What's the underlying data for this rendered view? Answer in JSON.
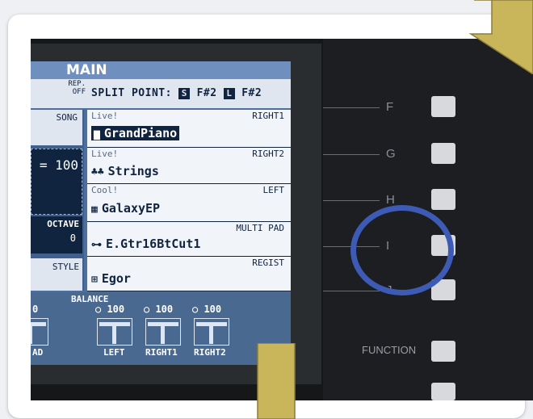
{
  "lcd": {
    "title": "MAIN",
    "rep_label": "REP.",
    "rep_value": "OFF",
    "split_point_label": "SPLIT POINT:",
    "split_s_icon": "S",
    "split_s_value": "F#2",
    "split_l_icon": "L",
    "split_l_value": "F#2",
    "song_label": "SONG",
    "tempo_value": "= 100",
    "octave_label": "OCTAVE",
    "octave_value": "0",
    "style_label": "STYLE",
    "voices": [
      {
        "sub": "Live!",
        "part": "RIGHT1",
        "icon": "piano-icon",
        "name": "GrandPiano"
      },
      {
        "sub": "Live!",
        "part": "RIGHT2",
        "icon": "strings-icon",
        "name": "Strings"
      },
      {
        "sub": "Cool!",
        "part": "LEFT",
        "icon": "keyboard-icon",
        "name": "GalaxyEP"
      },
      {
        "sub": "",
        "part": "MULTI PAD",
        "icon": "guitar-icon",
        "name": "E.Gtr16BtCut1"
      },
      {
        "sub": "",
        "part": "REGIST",
        "icon": "flag-icon",
        "name": "Egor"
      }
    ],
    "balance_title": "BALANCE",
    "balance_values": [
      "○ 100",
      "○ 100",
      "○ 100"
    ],
    "fader_labels": [
      "AD",
      "LEFT",
      "RIGHT1",
      "RIGHT2"
    ],
    "fader_first_value": "0"
  },
  "panel": {
    "letters": [
      "F",
      "G",
      "H",
      "I",
      "J"
    ],
    "function_label": "FUNCTION"
  },
  "annotations": {
    "arrow_color": "#c9b65a",
    "ring_color": "#3d5bb5"
  }
}
